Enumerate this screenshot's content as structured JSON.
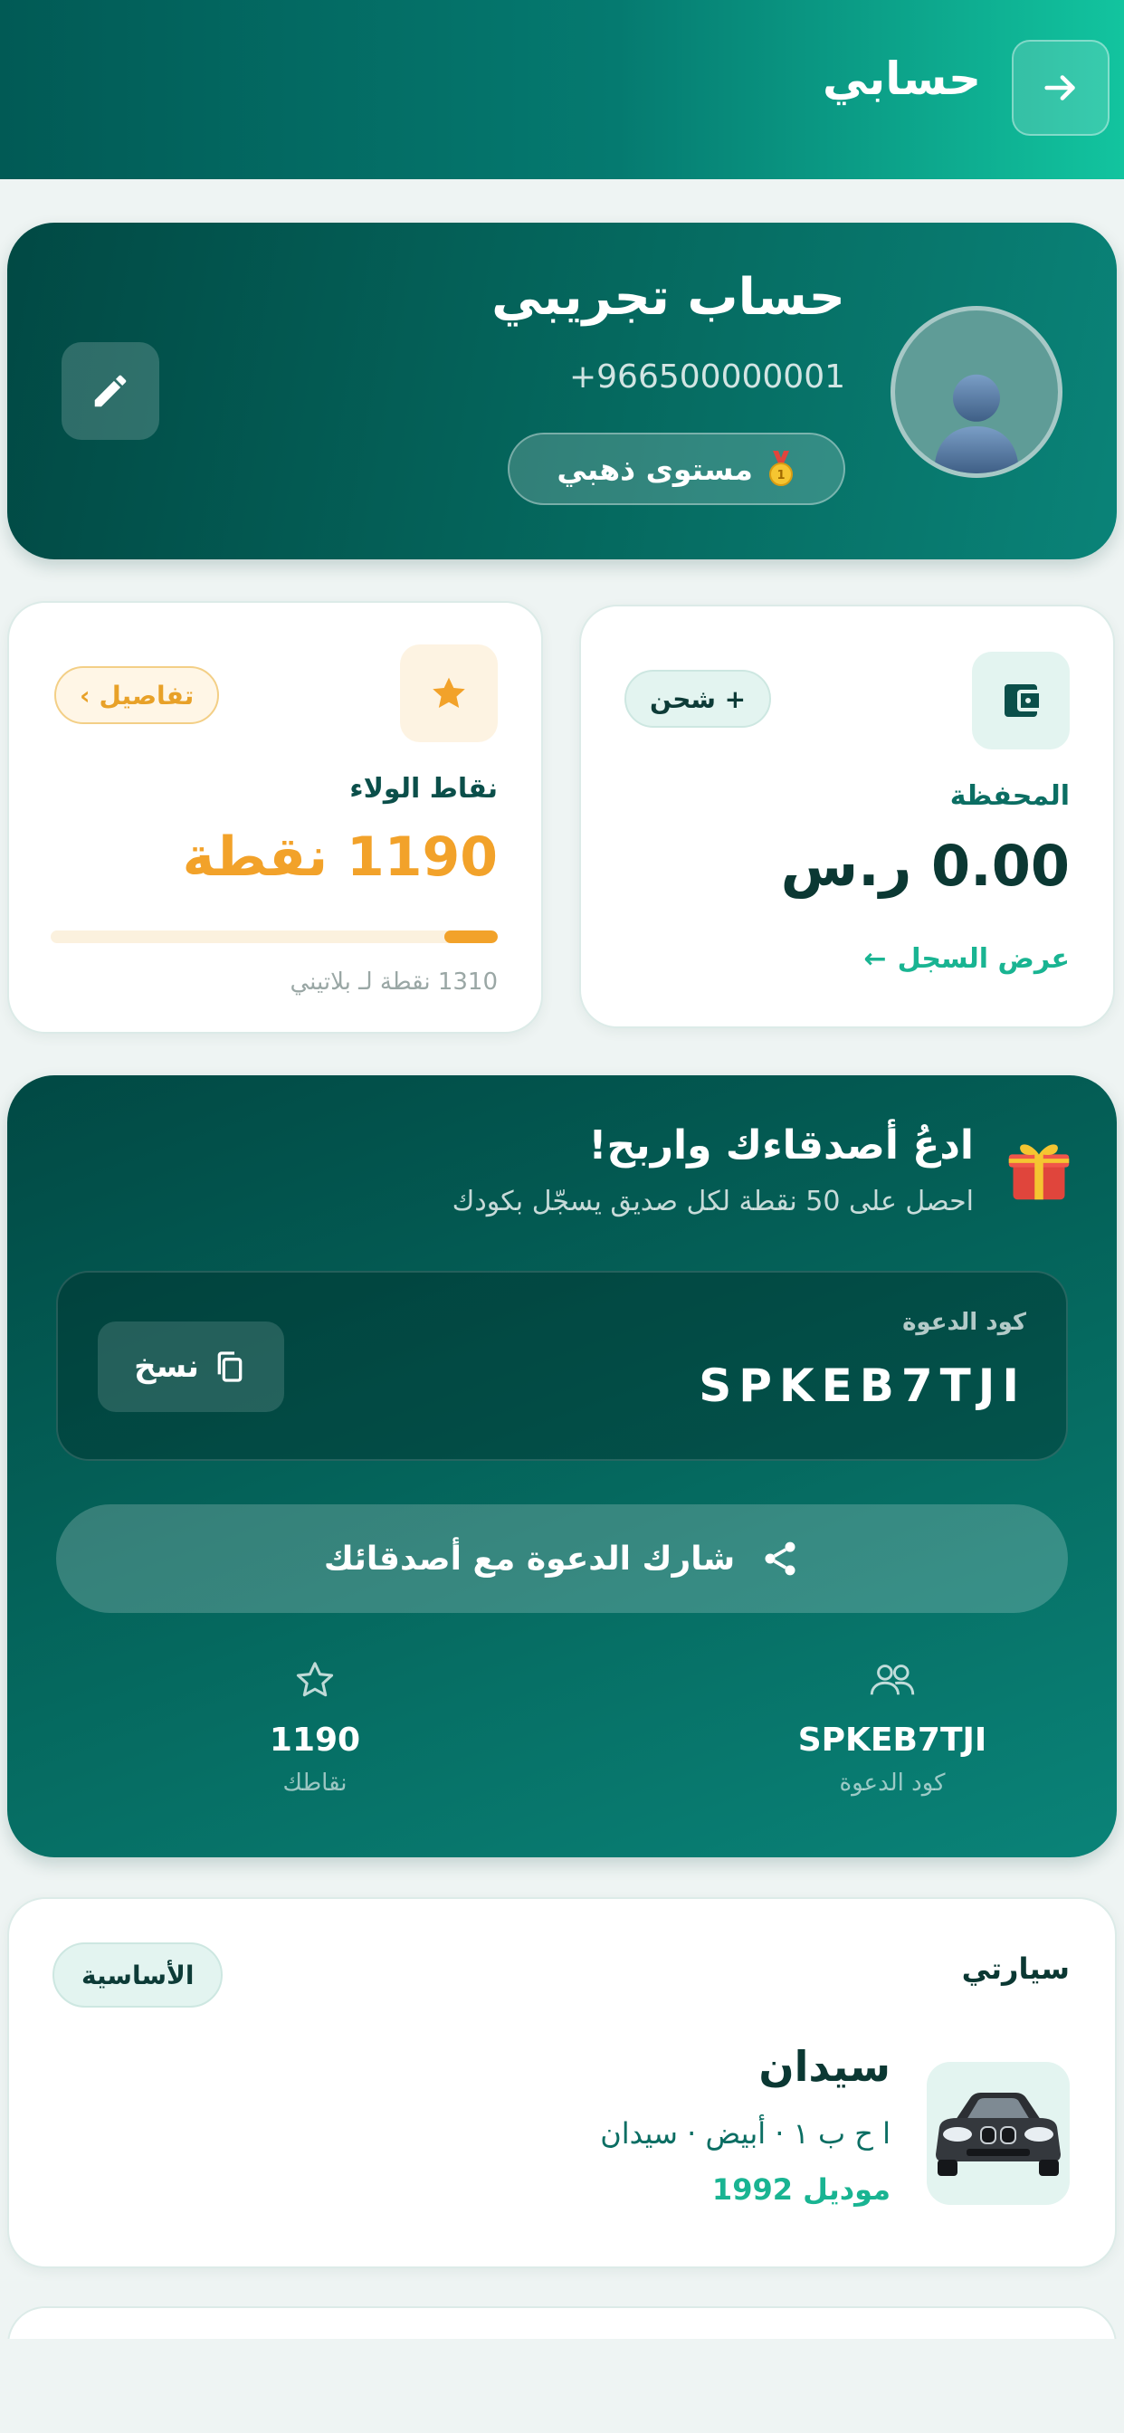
{
  "header": {
    "title": "حسابي",
    "back_icon": "arrow-right-icon"
  },
  "profile": {
    "name": "حساب تجريبي",
    "phone": "+966500000001",
    "level_label": "مستوى ذهبي",
    "level_icon": "medal-icon"
  },
  "wallet": {
    "label": "المحفظة",
    "amount": "0.00 ر.س",
    "topup_label": "+ شحن",
    "history_label": "عرض السجل",
    "history_arrow": "←"
  },
  "loyalty": {
    "label": "نقاط الولاء",
    "amount": "1190 نقطة",
    "details_label": "تفاصيل",
    "details_chevron": "›",
    "progress_percent": 12,
    "progress_note": "1310 نقطة لـ بلاتيني"
  },
  "invite": {
    "title": "ادعُ أصدقاءك واربح!",
    "subtitle": "احصل على 50 نقطة لكل صديق يسجّل بكودك",
    "code_label": "كود الدعوة",
    "code": "SPKEB7TJI",
    "copy_label": "نسخ",
    "share_label": "شارك الدعوة مع أصدقائك",
    "stats": {
      "code_value": "SPKEB7TJI",
      "code_label": "كود الدعوة",
      "points_value": "1190",
      "points_label": "نقاطك"
    }
  },
  "cars": {
    "section_title": "سيارتي",
    "primary_badge": "الأساسية",
    "car": {
      "name": "سيدان",
      "meta": "ا ح ب ١ · أبيض · سيدان",
      "model": "موديل 1992"
    }
  },
  "colors": {
    "primary_dark": "#014944",
    "accent_green": "#19b492",
    "gold": "#f2a22a"
  }
}
